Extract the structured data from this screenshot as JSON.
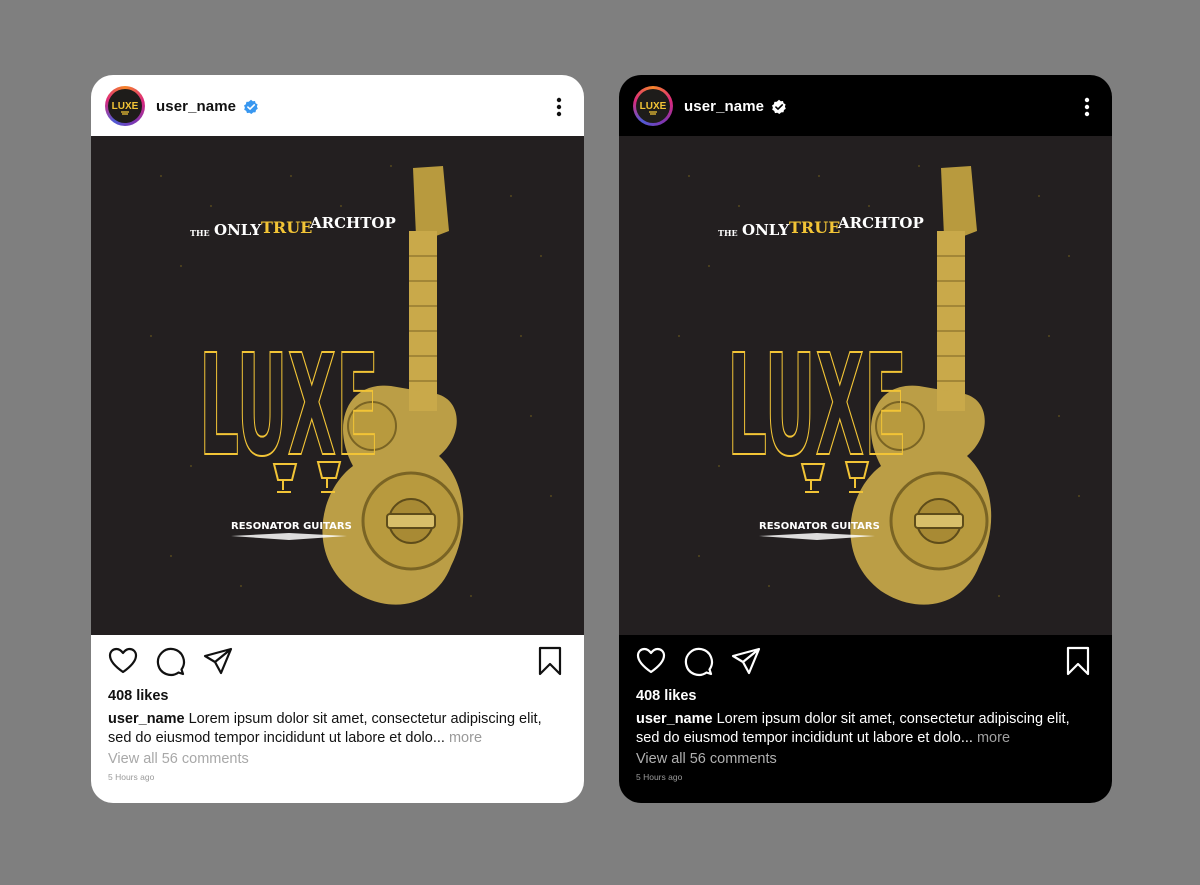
{
  "posts": [
    {
      "theme": "light",
      "username": "user_name",
      "verified_color": "#3897f0",
      "likes": "408 likes",
      "caption_user": "user_name",
      "caption_text": " Lorem ipsum dolor sit amet, consectetur adipiscing elit, sed do eiusmod tempor incididunt ut labore et dolo...",
      "caption_more": " more",
      "view_comments": "View all 56 comments",
      "time_ago": "5 Hours ago"
    },
    {
      "theme": "dark",
      "username": "user_name",
      "verified_color": "#ffffff",
      "likes": "408 likes",
      "caption_user": "user_name",
      "caption_text": " Lorem ipsum dolor sit amet, consectetur adipiscing elit, sed do eiusmod tempor incididunt ut labore et dolo...",
      "caption_more": " more",
      "view_comments": "View all 56 comments",
      "time_ago": "5 Hours ago"
    }
  ],
  "poster": {
    "kicker_the": "THE",
    "kicker_only": "ONLY",
    "kicker_true": "TRUE",
    "kicker_archtop": "ARCHTOP",
    "brand": "LUXE",
    "subtitle": "RESONATOR GUITARS",
    "avatar_text": "LUXE"
  },
  "colors": {
    "background": "#7f7f7f",
    "poster_bg": "#231f20",
    "gold": "#f2c436",
    "guitar": "#c9a94a"
  },
  "icons": [
    "heart-icon",
    "comment-icon",
    "share-icon",
    "bookmark-icon",
    "more-vertical-icon",
    "verified-badge-icon"
  ]
}
